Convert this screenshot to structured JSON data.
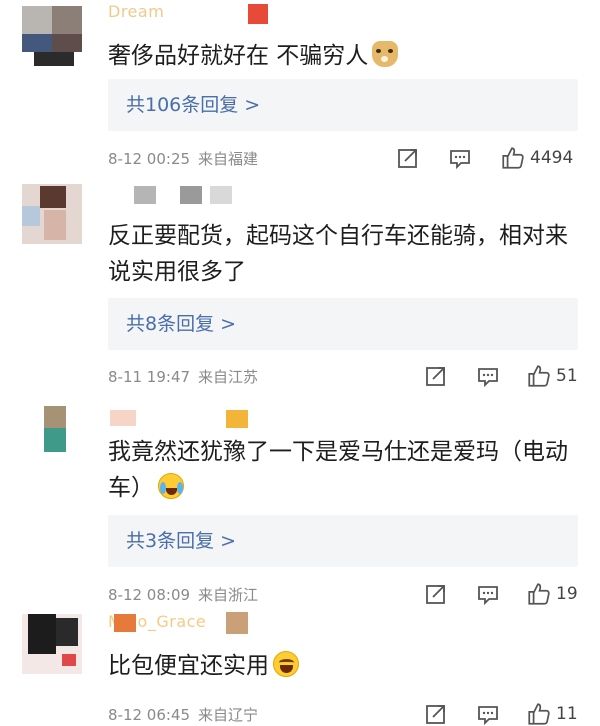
{
  "comments": [
    {
      "username": "Dream",
      "text": "奢侈品好就好在 不骗穷人",
      "emoji": "doge",
      "replies_label": "共106条回复",
      "arrow": ">",
      "date": "8-12 00:25",
      "location": "来自福建",
      "likes": "4494"
    },
    {
      "username": "",
      "text": "反正要配货，起码这个自行车还能骑，相对来说实用很多了",
      "emoji": "",
      "replies_label": "共8条回复",
      "arrow": ">",
      "date": "8-11 19:47",
      "location": "来自江苏",
      "likes": "51"
    },
    {
      "username": "",
      "text": "我竟然还犹豫了一下是爱马仕还是爱玛（电动车）",
      "emoji": "cry",
      "replies_label": "共3条回复",
      "arrow": ">",
      "date": "8-12 08:09",
      "location": "来自浙江",
      "likes": "19"
    },
    {
      "username": "Miao_Grace",
      "text": "比包便宜还实用",
      "emoji": "laugh",
      "replies_label": "",
      "arrow": "",
      "date": "8-12 06:45",
      "location": "来自辽宁",
      "likes": "11"
    }
  ],
  "icons": {
    "share": "share-icon",
    "comment": "comment-icon",
    "like": "thumbs-up-icon"
  },
  "colors": {
    "reply_link": "#4a6ea9",
    "meta_gray": "#8a8a8a",
    "reply_bg": "#f4f5f7"
  }
}
